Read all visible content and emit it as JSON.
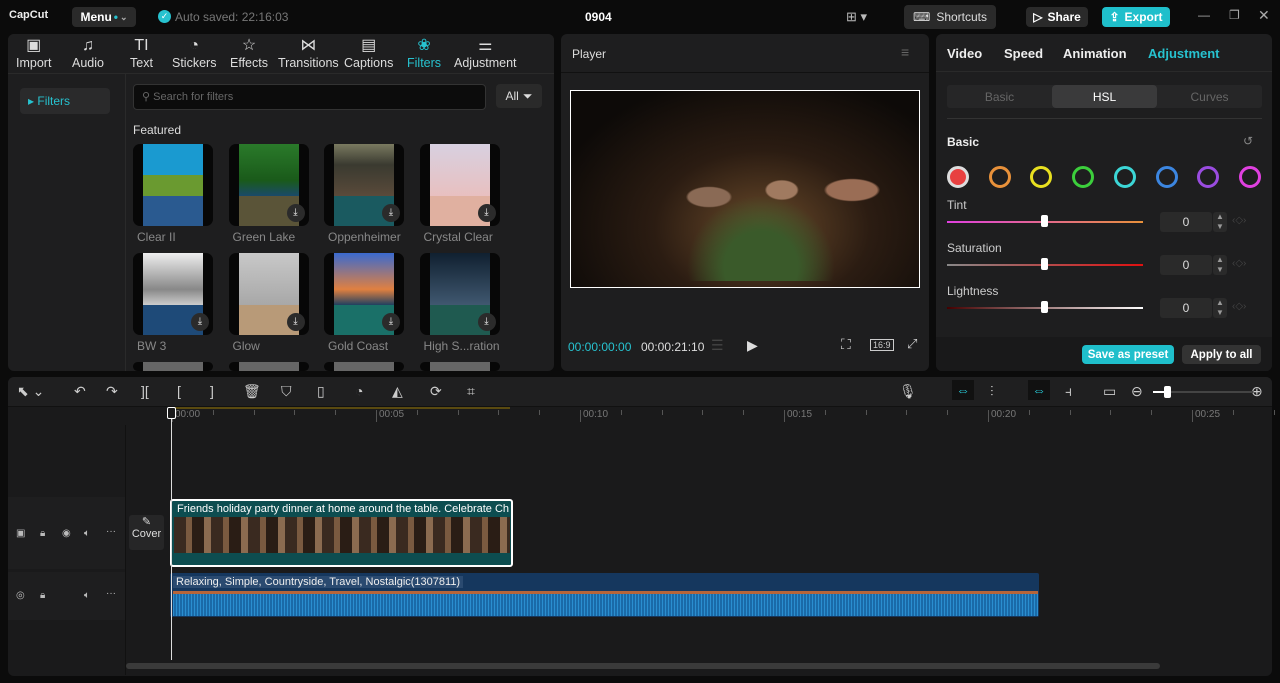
{
  "app": {
    "logo": "CapCut",
    "menu": "Menu",
    "autosave": "Auto saved: 22:16:03",
    "project": "0904",
    "shortcuts": "Shortcuts",
    "share": "Share",
    "export": "Export",
    "accent": "#27c2cf"
  },
  "media_tabs": [
    {
      "label": "Import",
      "icon": "import-icon"
    },
    {
      "label": "Audio",
      "icon": "audio-icon"
    },
    {
      "label": "Text",
      "icon": "text-icon"
    },
    {
      "label": "Stickers",
      "icon": "stickers-icon"
    },
    {
      "label": "Effects",
      "icon": "effects-icon"
    },
    {
      "label": "Transitions",
      "icon": "transitions-icon"
    },
    {
      "label": "Captions",
      "icon": "captions-icon"
    },
    {
      "label": "Filters",
      "icon": "filters-icon"
    },
    {
      "label": "Adjustment",
      "icon": "adjustment-icon"
    }
  ],
  "filters": {
    "sidebar_item": "Filters",
    "search_placeholder": "Search for filters",
    "all": "All",
    "section": "Featured",
    "items": [
      {
        "name": "Clear II"
      },
      {
        "name": "Green Lake"
      },
      {
        "name": "Oppenheimer"
      },
      {
        "name": "Crystal Clear"
      },
      {
        "name": "BW 3"
      },
      {
        "name": "Glow"
      },
      {
        "name": "Gold Coast"
      },
      {
        "name": "High S...ration"
      }
    ]
  },
  "player": {
    "title": "Player",
    "current": "00:00:00:00",
    "total": "00:00:21:10",
    "ratio": "16:9"
  },
  "inspector": {
    "tabs": [
      "Video",
      "Speed",
      "Animation",
      "Adjustment"
    ],
    "subtabs": [
      "Basic",
      "HSL",
      "Curves"
    ],
    "section": "Basic",
    "colors": [
      "#e84040",
      "#e8913a",
      "#e8e020",
      "#3ccf3c",
      "#3cd6d6",
      "#3c86e0",
      "#9a4ce0",
      "#e040e0"
    ],
    "sliders": [
      {
        "label": "Tint",
        "value": "0"
      },
      {
        "label": "Saturation",
        "value": "0"
      },
      {
        "label": "Lightness",
        "value": "0"
      }
    ],
    "save_preset": "Save as preset",
    "apply_all": "Apply to all"
  },
  "timeline": {
    "ruler": [
      "00:00",
      "00:05",
      "00:10",
      "00:15",
      "00:20",
      "00:25"
    ],
    "cover": "Cover",
    "video_clip": "Friends holiday party dinner at home around the table. Celebrate Ch",
    "audio_clip": "Relaxing, Simple, Countryside, Travel, Nostalgic(1307811)"
  }
}
